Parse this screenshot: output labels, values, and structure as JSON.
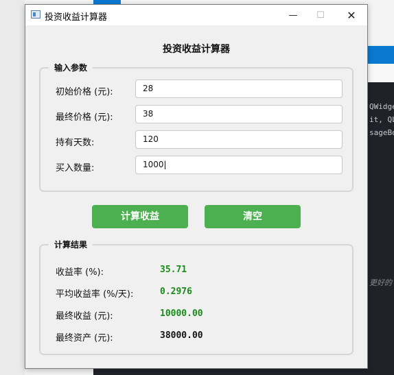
{
  "window": {
    "title": "投资收益计算器",
    "heading": "投资收益计算器",
    "min_glyph": "—",
    "max_glyph": "☐",
    "close_glyph": "✕"
  },
  "inputs_group": {
    "title": "输入参数",
    "fields": [
      {
        "label": "初始价格 (元):",
        "value": "28"
      },
      {
        "label": "最终价格 (元):",
        "value": "38"
      },
      {
        "label": "持有天数:",
        "value": "120"
      },
      {
        "label": "买入数量:",
        "value": "1000|"
      }
    ]
  },
  "buttons": {
    "calculate": "计算收益",
    "clear": "清空"
  },
  "results_group": {
    "title": "计算结果",
    "rows": [
      {
        "label": "收益率 (%):",
        "value": "35.71",
        "color": "#1a8a1a"
      },
      {
        "label": "平均收益率 (%/天):",
        "value": "0.2976",
        "color": "#1a8a1a"
      },
      {
        "label": "最终收益 (元):",
        "value": "10000.00",
        "color": "#1a8a1a"
      },
      {
        "label": "最终资产 (元):",
        "value": "38000.00",
        "color": "#111111"
      }
    ]
  },
  "background": {
    "code_lines": [
      "QWidget",
      "it, QL",
      "sageBo",
      "更好的"
    ]
  },
  "colors": {
    "button_green": "#4caf50",
    "positive_value": "#1a8a1a"
  }
}
